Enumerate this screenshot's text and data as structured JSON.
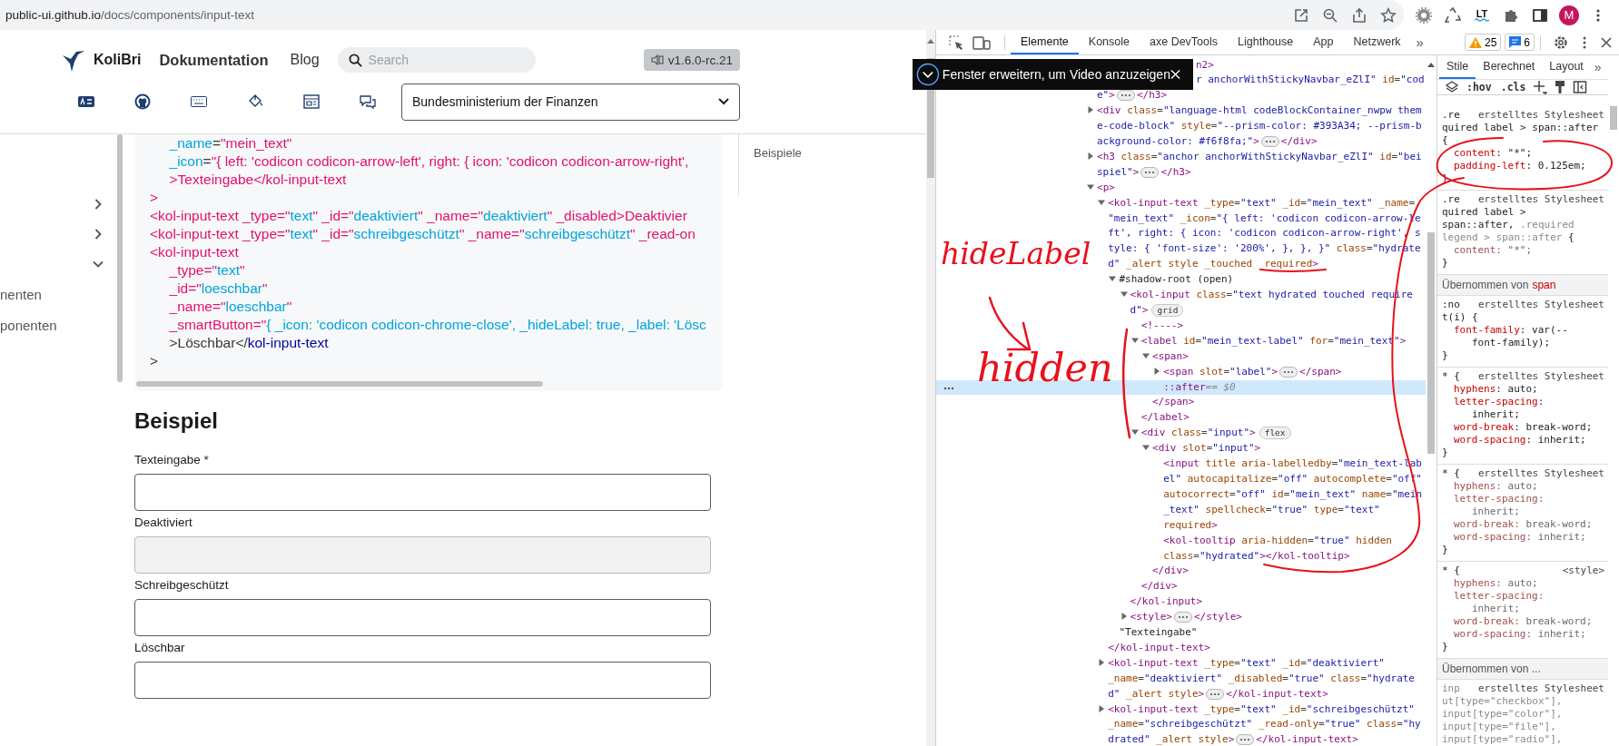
{
  "browser": {
    "address_host": "public-ui.github.io",
    "address_path": "/docs/components/input-text",
    "extension_label": "LT",
    "avatar_letter": "M"
  },
  "site_header": {
    "logo_text": "KoliBri",
    "nav": [
      {
        "label": "Dokumentation",
        "selected": true
      },
      {
        "label": "Blog",
        "selected": false
      }
    ],
    "search": {
      "placeholder": "Search"
    },
    "version": "v1.6.0-rc.21",
    "theme_select": "Bundesministerium der Finanzen"
  },
  "sidebar": {
    "items": [
      {
        "expanded": false
      },
      {
        "expanded": false
      },
      {
        "expanded": true,
        "children": [
          {
            "label": "nenten"
          },
          {
            "label": "ponenten"
          }
        ]
      }
    ]
  },
  "code_block": {
    "lines": [
      "     _name=\"mein_text\"",
      "     _icon=\"{ left: 'codicon codicon-arrow-left', right: { icon: 'codicon codicon-arrow-right',",
      "     >Texteingabe</kol-input-text",
      ">",
      "<kol-input-text _type=\"text\" _id=\"deaktiviert\" _name=\"deaktiviert\" _disabled>Deaktivier",
      "<kol-input-text _type=\"text\" _id=\"schreibgeschützt\" _name=\"schreibgeschützt\" _read-on",
      "<kol-input-text",
      "     _type=\"text\"",
      "     _id=\"loeschbar\"",
      "     _name=\"loeschbar\"",
      "     _smartButton=\"{ _icon: 'codicon codicon-chrome-close', _hideLabel: true, _label: 'Lösc",
      "     >Löschbar</kol-input-text",
      ">"
    ]
  },
  "toc": {
    "items": [
      "Beispiele"
    ]
  },
  "example": {
    "heading": "Beispiel",
    "fields": [
      {
        "label": "Texteingabe *",
        "disabled": false
      },
      {
        "label": "Deaktiviert",
        "disabled": true
      },
      {
        "label": "Schreibgeschützt",
        "disabled": false
      },
      {
        "label": "Löschbar",
        "disabled": false
      }
    ]
  },
  "video_toast": {
    "text": "Fenster erweitern, um Video anzuzeigen"
  },
  "devtools": {
    "tabs": [
      {
        "label": "Elemente",
        "selected": true
      },
      {
        "label": "Konsole",
        "selected": false
      },
      {
        "label": "axe DevTools",
        "selected": false
      },
      {
        "label": "Lighthouse",
        "selected": false
      },
      {
        "label": "App",
        "selected": false
      },
      {
        "label": "Netzwerk",
        "selected": false
      }
    ],
    "more_tabs": "»",
    "warnings": "25",
    "messages": "6",
    "elements": [
      {
        "kind": "clipped-text",
        "selected": false,
        "lines": [
          "n2>"
        ]
      },
      {
        "kind": "clipped-element",
        "selected": false,
        "expanded": false,
        "lines": [
          "r anchorWithStickyNavbar_eZlI\" id=\"cod",
          "e\">"
        ],
        "close": "</h3>"
      },
      {
        "kind": "element",
        "selected": false,
        "expanded": false,
        "lines": [
          "<div class=\"language-html codeBlockContainer_nwpw them",
          "e-code-block\" style=\"--prism-color: #393A34; --prism-b",
          "ackground-color: #f6f8fa;\">"
        ],
        "close": "</div>"
      },
      {
        "kind": "element",
        "selected": false,
        "expanded": false,
        "lines": [
          "<h3 class=\"anchor anchorWithStickyNavbar_eZlI\" id=\"bei",
          "spiel\">"
        ],
        "close": "</h3>"
      },
      {
        "kind": "element",
        "selected": false,
        "expanded": true,
        "lines": [
          "<p>"
        ],
        "children": [
          {
            "kind": "element",
            "selected": false,
            "expanded": true,
            "lines": [
              "<kol-input-text _type=\"text\" _id=\"mein_text\" _name=",
              "\"mein_text\" _icon=\"{ left: 'codicon codicon-arrow-le",
              "ft', right: { icon: 'codicon codicon-arrow-right', s",
              "tyle: { 'font-size': '200%', }, }, }\" class=\"hydrate",
              "d\" _alert style _touched _required>"
            ],
            "children": [
              {
                "kind": "element",
                "selected": false,
                "expanded": true,
                "lines": [
                  "#shadow-root (open)"
                ],
                "children": [
                  {
                    "kind": "element",
                    "selected": false,
                    "expanded": true,
                    "lines": [
                      "<kol-input class=\"text hydrated touched require",
                      "d\">"
                    ],
                    "badge": "grid",
                    "children": [
                      {
                        "kind": "leaf",
                        "selected": false,
                        "lines": [
                          "<!---->"
                        ]
                      },
                      {
                        "kind": "element",
                        "selected": false,
                        "expanded": true,
                        "lines": [
                          "<label id=\"mein_text-label\" for=\"mein_text\">"
                        ],
                        "children": [
                          {
                            "kind": "element",
                            "selected": false,
                            "expanded": true,
                            "lines": [
                              "<span>"
                            ],
                            "children": [
                              {
                                "kind": "element",
                                "selected": false,
                                "expanded": false,
                                "lines": [
                                  "<span slot=\"label\">"
                                ],
                                "close": "</span>"
                              },
                              {
                                "kind": "pseudo",
                                "selected": true,
                                "lines": [
                                  "::after"
                                ],
                                "note": "== $0"
                              }
                            ],
                            "close": "</span>"
                          }
                        ],
                        "close": "</label>"
                      },
                      {
                        "kind": "element",
                        "selected": false,
                        "expanded": true,
                        "lines": [
                          "<div class=\"input\">"
                        ],
                        "badge": "flex",
                        "children": [
                          {
                            "kind": "element",
                            "selected": false,
                            "expanded": true,
                            "lines": [
                              "<div slot=\"input\">"
                            ],
                            "children": [
                              {
                                "kind": "leaf",
                                "selected": false,
                                "lines": [
                                  "<input title aria-labelledby=\"mein_text-lab",
                                  "el\" autocapitalize=\"off\" autocomplete=\"off\"",
                                  "autocorrect=\"off\" id=\"mein_text\" name=\"mein",
                                  "_text\" spellcheck=\"true\" type=\"text\"",
                                  "required>"
                                ]
                              },
                              {
                                "kind": "leaf",
                                "selected": false,
                                "lines": [
                                  "<kol-tooltip aria-hidden=\"true\" hidden",
                                  "class=\"hydrated\"></kol-tooltip>"
                                ]
                              }
                            ],
                            "close": "</div>"
                          }
                        ],
                        "close": "</div>"
                      }
                    ],
                    "close": "</kol-input>"
                  },
                  {
                    "kind": "element",
                    "selected": false,
                    "expanded": false,
                    "lines": [
                      "<style>"
                    ],
                    "close": "</style>"
                  }
                ]
              },
              {
                "kind": "text",
                "selected": false,
                "lines": [
                  "\"Texteingabe\""
                ]
              }
            ],
            "close": "</kol-input-text>"
          },
          {
            "kind": "element",
            "selected": false,
            "expanded": false,
            "lines": [
              "<kol-input-text _type=\"text\" _id=\"deaktiviert\"",
              "_name=\"deaktiviert\" _disabled=\"true\" class=\"hydrate",
              "d\" _alert style>"
            ],
            "close": "</kol-input-text>"
          },
          {
            "kind": "element",
            "selected": false,
            "expanded": false,
            "lines": [
              "<kol-input-text _type=\"text\" _id=\"schreibgeschützt\"",
              "_name=\"schreibgeschützt\" _read-only=\"true\" class=\"hy",
              "drated\" _alert style>"
            ],
            "close": "</kol-input-text>"
          }
        ]
      }
    ],
    "styles": {
      "tabs": [
        {
          "label": "Stile",
          "selected": true
        },
        {
          "label": "Berechnet",
          "selected": false
        },
        {
          "label": "Layout",
          "selected": false
        }
      ],
      "more_tabs": "»",
      "filter_buttons": [
        ":hov",
        ".cls"
      ],
      "sections": [
        {
          "kind": "rule",
          "source": "erstelltes Stylesheet",
          "selector": [
            [
              {
                "text": ".re",
                "matched": true
              }
            ],
            [
              {
                "text": "quired label > span::after",
                "matched": true
              }
            ],
            [
              {
                "text": "{",
                "matched": true
              }
            ]
          ],
          "declarations": [
            {
              "lines": [
                "content: \"*\";"
              ],
              "overridden": false
            },
            {
              "lines": [
                "padding-left: 0.125em;"
              ],
              "overridden": false
            }
          ],
          "close": "}"
        },
        {
          "kind": "rule",
          "source": "erstelltes Stylesheet",
          "selector": [
            [
              {
                "text": ".re",
                "matched": true
              }
            ],
            [
              {
                "text": "quired label >",
                "matched": true
              }
            ],
            [
              {
                "text": "span::after,",
                "matched": true
              },
              {
                "text": " .required",
                "matched": false
              }
            ],
            [
              {
                "text": "legend > span::after",
                "matched": false
              },
              {
                "text": " {",
                "matched": true
              }
            ]
          ],
          "declarations": [
            {
              "lines": [
                "content: \"*\";"
              ],
              "overridden": true
            }
          ],
          "close": "}"
        },
        {
          "kind": "inherited",
          "label": "Übernommen von",
          "element": "span"
        },
        {
          "kind": "rule",
          "source": "erstelltes Stylesheet",
          "selector": [
            [
              {
                "text": ":no",
                "matched": true
              }
            ],
            [
              {
                "text": "t(i) {",
                "matched": true
              }
            ]
          ],
          "declarations": [
            {
              "lines": [
                "font-family: var(--",
                "font-family);"
              ],
              "overridden": false
            }
          ],
          "close": "}"
        },
        {
          "kind": "rule",
          "source": "erstelltes Stylesheet",
          "selector": [
            [
              {
                "text": "* {",
                "matched": true
              }
            ]
          ],
          "declarations": [
            {
              "lines": [
                "hyphens: auto;"
              ],
              "overridden": false
            },
            {
              "lines": [
                "letter-spacing:",
                "inherit;"
              ],
              "overridden": false
            },
            {
              "lines": [
                "word-break: break-word;"
              ],
              "overridden": false
            },
            {
              "lines": [
                "word-spacing: inherit;"
              ],
              "overridden": false
            }
          ],
          "close": "}"
        },
        {
          "kind": "rule",
          "source": "erstelltes Stylesheet",
          "selector": [
            [
              {
                "text": "* {",
                "matched": true
              }
            ]
          ],
          "declarations": [
            {
              "lines": [
                "hyphens: auto;"
              ],
              "overridden": true
            },
            {
              "lines": [
                "letter-spacing:",
                "inherit;"
              ],
              "overridden": true
            },
            {
              "lines": [
                "word-break: break-word;"
              ],
              "overridden": true
            },
            {
              "lines": [
                "word-spacing: inherit;"
              ],
              "overridden": true
            }
          ],
          "close": "}"
        },
        {
          "kind": "rule",
          "source": "<style>",
          "selector": [
            [
              {
                "text": "* {",
                "matched": true
              }
            ]
          ],
          "declarations": [
            {
              "lines": [
                "hyphens: auto;"
              ],
              "overridden": true
            },
            {
              "lines": [
                "letter-spacing:",
                "inherit;"
              ],
              "overridden": true
            },
            {
              "lines": [
                "word-break: break-word;"
              ],
              "overridden": true
            },
            {
              "lines": [
                "word-spacing: inherit;"
              ],
              "overridden": true
            }
          ],
          "close": "}"
        },
        {
          "kind": "inherited",
          "label": "Übernommen von ..."
        },
        {
          "kind": "rule",
          "source": "erstelltes Stylesheet",
          "selector": [
            [
              {
                "text": "inp",
                "matched": false
              }
            ],
            [
              {
                "text": "ut[type=\"checkbox\"],",
                "matched": false
              }
            ],
            [
              {
                "text": "input[type=\"color\"],",
                "matched": false
              }
            ],
            [
              {
                "text": "input[type=\"file\"],",
                "matched": false
              }
            ],
            [
              {
                "text": "input[type=\"radio\"],",
                "matched": false
              }
            ]
          ]
        }
      ]
    }
  },
  "annotations": [
    {
      "kind": "handwriting",
      "text": "hideLabel"
    },
    {
      "kind": "handwriting",
      "text": "hidden"
    }
  ]
}
